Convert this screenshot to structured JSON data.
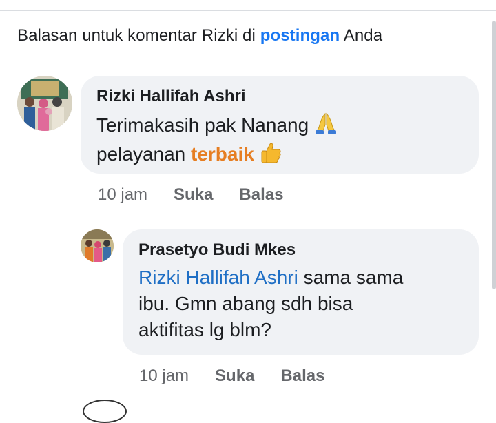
{
  "header": {
    "prefix": "Balasan untuk komentar Rizki di ",
    "link": "postingan",
    "suffix": " Anda"
  },
  "comments": [
    {
      "author": "Rizki Hallifah Ashri",
      "line1": "Terimakasih pak Nanang",
      "line2_prefix": "pelayanan ",
      "line2_highlight": "terbaik",
      "emoji1": "folded-hands-icon",
      "emoji2": "thumbs-up-icon",
      "time": "10 jam",
      "like": "Suka",
      "reply": "Balas"
    },
    {
      "author": "Prasetyo Budi Mkes",
      "mention": "Rizki Hallifah Ashri",
      "line1_rest": " sama sama",
      "line2": "ibu. Gmn abang sdh bisa",
      "line3": "aktifitas lg blm?",
      "time": "10 jam",
      "like": "Suka",
      "reply": "Balas"
    }
  ],
  "colors": {
    "link": "#1877f2",
    "mention": "#1f6fc5",
    "highlight": "#e67e22",
    "bubble": "#f0f2f5",
    "meta": "#65676b"
  }
}
